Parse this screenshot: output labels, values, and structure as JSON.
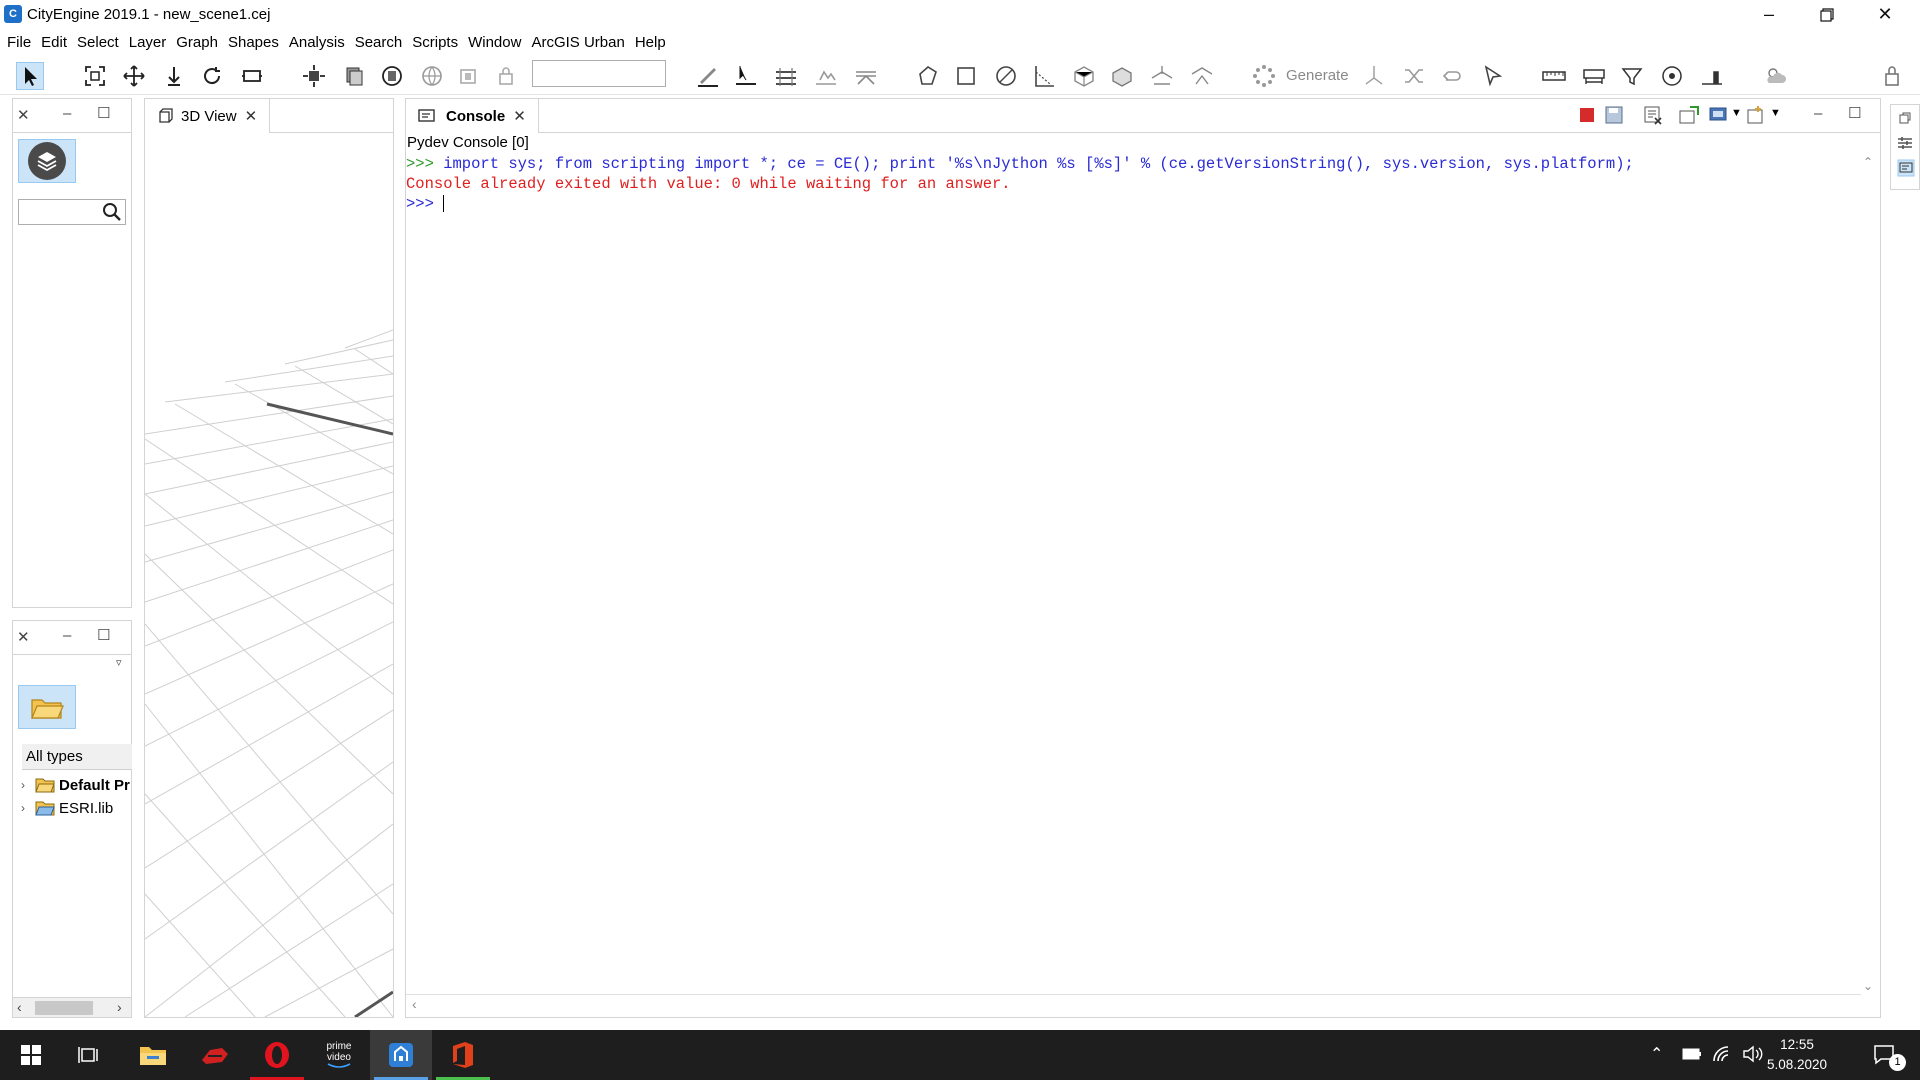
{
  "window": {
    "title": "CityEngine 2019.1 - new_scene1.cej",
    "app_icon": "cityengine-icon",
    "controls": [
      "minimize",
      "restore",
      "close"
    ]
  },
  "menu": [
    "File",
    "Edit",
    "Select",
    "Layer",
    "Graph",
    "Shapes",
    "Analysis",
    "Search",
    "Scripts",
    "Window",
    "ArcGIS Urban",
    "Help"
  ],
  "toolbar": {
    "search_value": "",
    "generate_label": "Generate"
  },
  "scene_panel": {
    "search_value": ""
  },
  "navigator_panel": {
    "filter": "All types",
    "tree": [
      {
        "label": "Default Pr",
        "bold": true
      },
      {
        "label": "ESRI.lib",
        "bold": false
      }
    ]
  },
  "view_panel": {
    "tab_label": "3D View"
  },
  "console_panel": {
    "tab_label": "Console",
    "subtitle": "Pydev Console [0]",
    "prompt": ">>>",
    "command": " import sys; from scripting import *; ce = CE(); print '%s\\nJython %s [%s]' % (ce.getVersionString(), sys.version, sys.platform);",
    "error_line": "Console already exited with value: 0 while waiting for an answer.",
    "input_prompt": ">>> ",
    "colors": {
      "command": "#2a2ad6",
      "prompt": "#2e9a2e",
      "error": "#e02020"
    }
  },
  "taskbar": {
    "apps": [
      "start-icon",
      "task-view-icon",
      "file-explorer-icon",
      "game-icon",
      "opera-icon",
      "prime-video-icon",
      "cityengine-icon",
      "office-icon"
    ],
    "prime_label_1": "prime",
    "prime_label_2": "video",
    "time": "12:55",
    "date": "5.08.2020",
    "notifications": "1"
  }
}
